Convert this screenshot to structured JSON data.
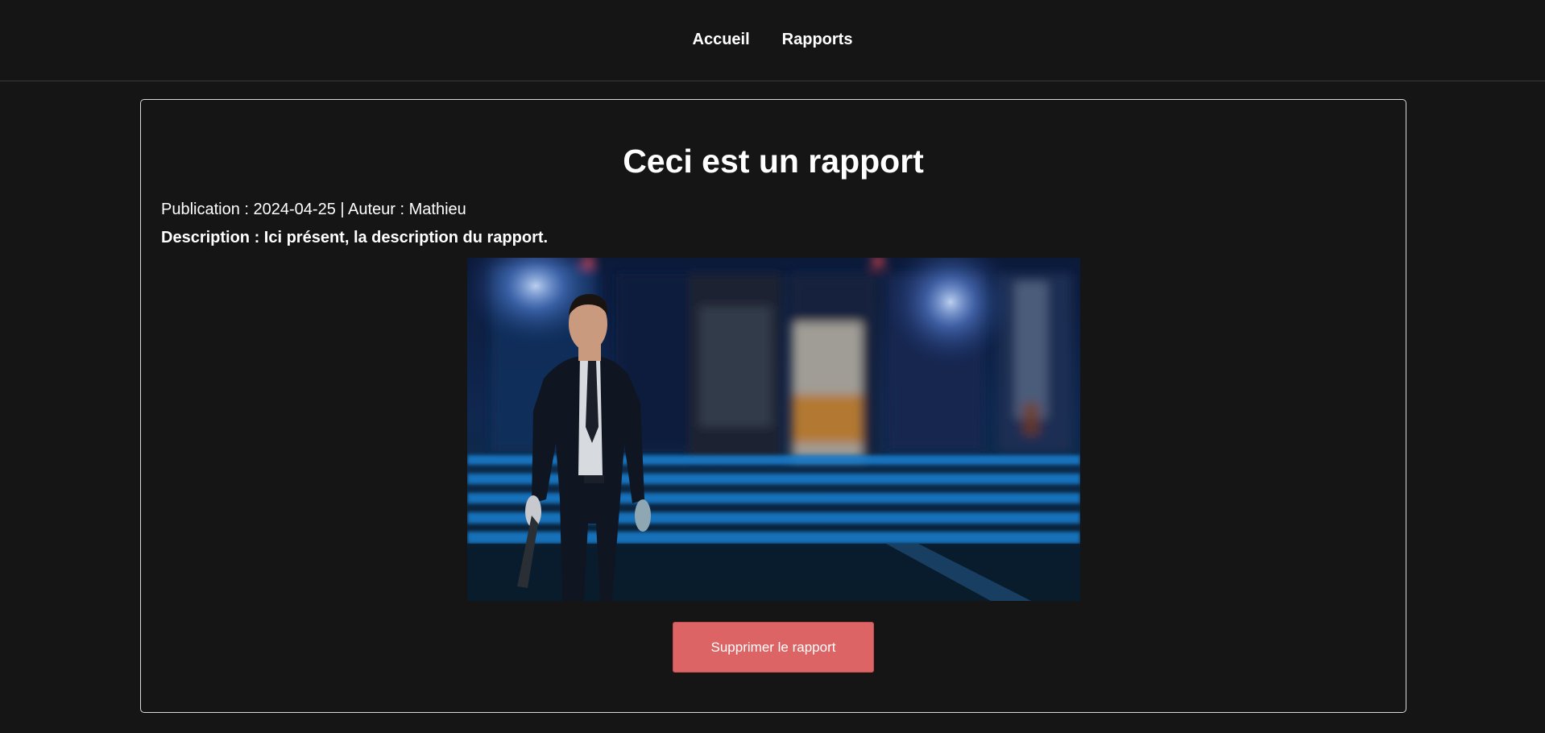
{
  "nav": {
    "items": [
      {
        "label": "Accueil"
      },
      {
        "label": "Rapports"
      }
    ]
  },
  "report": {
    "title": "Ceci est un rapport",
    "meta": "Publication : 2024-04-25 | Auteur : Mathieu",
    "description": "Description : Ici présent, la description du rapport.",
    "delete_label": "Supprimer le rapport"
  },
  "colors": {
    "background": "#151515",
    "card_border": "#d9d9d9",
    "danger_button": "#dd6464"
  }
}
